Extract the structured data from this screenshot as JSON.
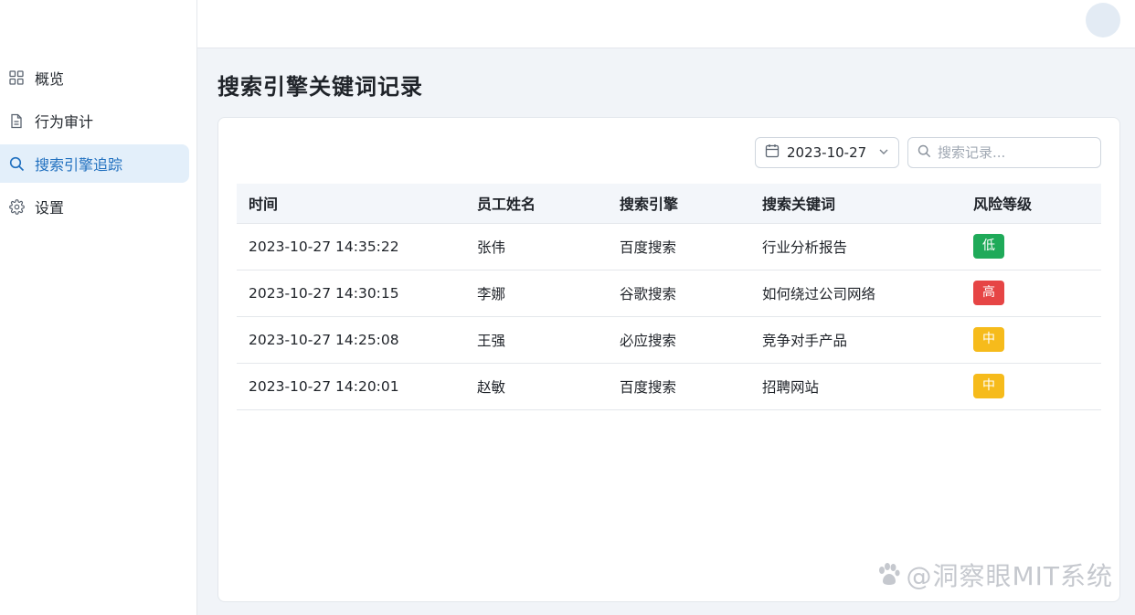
{
  "sidebar": {
    "items": [
      {
        "label": "概览",
        "icon": "grid-icon",
        "active": false
      },
      {
        "label": "行为审计",
        "icon": "file-icon",
        "active": false
      },
      {
        "label": "搜索引擎追踪",
        "icon": "search-icon",
        "active": true
      },
      {
        "label": "设置",
        "icon": "gear-icon",
        "active": false
      }
    ]
  },
  "page": {
    "title": "搜索引擎关键词记录"
  },
  "filters": {
    "date": "2023-10-27",
    "search_placeholder": "搜索记录..."
  },
  "table": {
    "columns": [
      "时间",
      "员工姓名",
      "搜索引擎",
      "搜索关键词",
      "风险等级"
    ],
    "rows": [
      {
        "time": "2023-10-27 14:35:22",
        "employee": "张伟",
        "engine": "百度搜索",
        "keyword": "行业分析报告",
        "risk": "低"
      },
      {
        "time": "2023-10-27 14:30:15",
        "employee": "李娜",
        "engine": "谷歌搜索",
        "keyword": "如何绕过公司网络",
        "risk": "高"
      },
      {
        "time": "2023-10-27 14:25:08",
        "employee": "王强",
        "engine": "必应搜索",
        "keyword": "竞争对手产品",
        "risk": "中"
      },
      {
        "time": "2023-10-27 14:20:01",
        "employee": "赵敏",
        "engine": "百度搜索",
        "keyword": "招聘网站",
        "risk": "中"
      }
    ]
  },
  "risk_colors": {
    "低": "#1faa59",
    "中": "#f6bb1b",
    "高": "#e64545"
  },
  "colors": {
    "accent": "#1f6fbf",
    "active_bg": "#e3effa"
  },
  "watermark": {
    "text": "@洞察眼MIT系统"
  }
}
